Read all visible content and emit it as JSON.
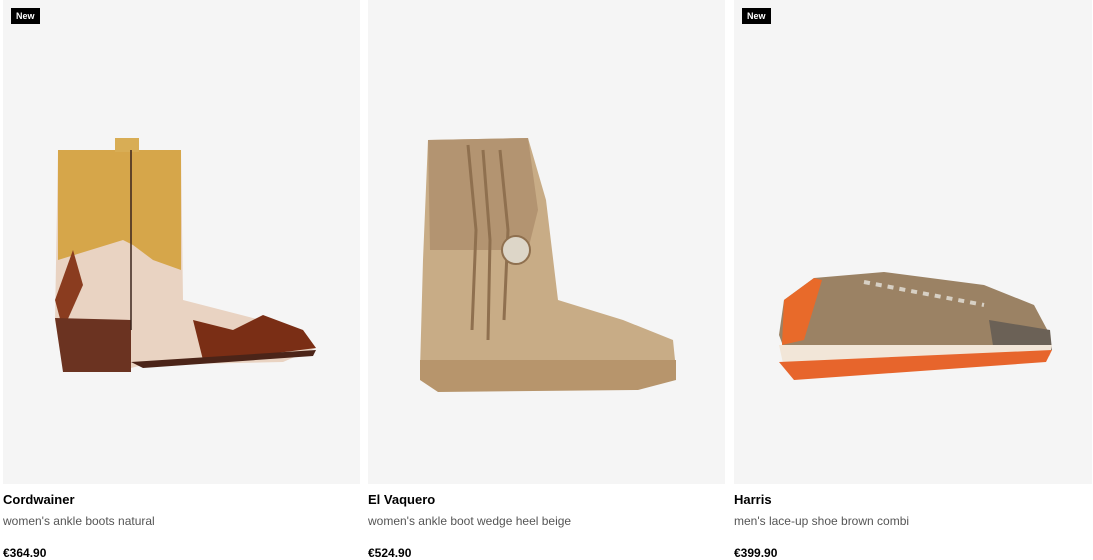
{
  "products": [
    {
      "badge": "New",
      "brand": "Cordwainer",
      "description": "women's ankle boots natural",
      "price": "€364.90",
      "image": "ankle-boot-tan-cream-western"
    },
    {
      "badge": "",
      "brand": "El Vaquero",
      "description": "women's ankle boot wedge heel beige",
      "price": "€524.90",
      "image": "fringed-boot-beige"
    },
    {
      "badge": "New",
      "brand": "Harris",
      "description": "men's lace-up shoe brown combi",
      "price": "€399.90",
      "image": "sneaker-brown-orange-sole"
    }
  ]
}
